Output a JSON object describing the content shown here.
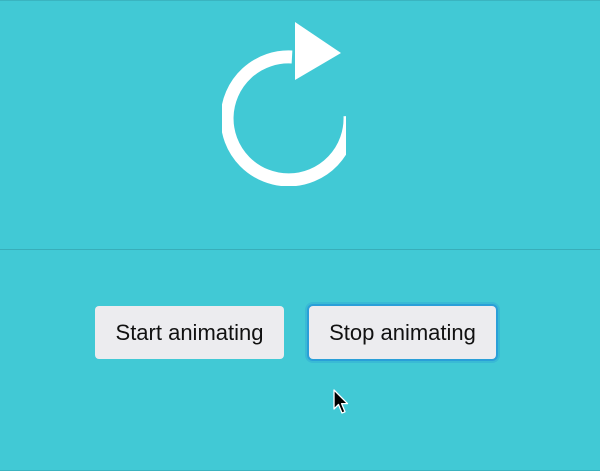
{
  "colors": {
    "background": "#41c9d5",
    "icon": "#ffffff",
    "button_bg": "#ececef",
    "focus_ring": "#2a9fd8"
  },
  "animation": {
    "icon": "refresh-icon"
  },
  "controls": {
    "start_label": "Start animating",
    "stop_label": "Stop animating"
  },
  "cursor": {
    "icon": "arrow-cursor-icon"
  }
}
